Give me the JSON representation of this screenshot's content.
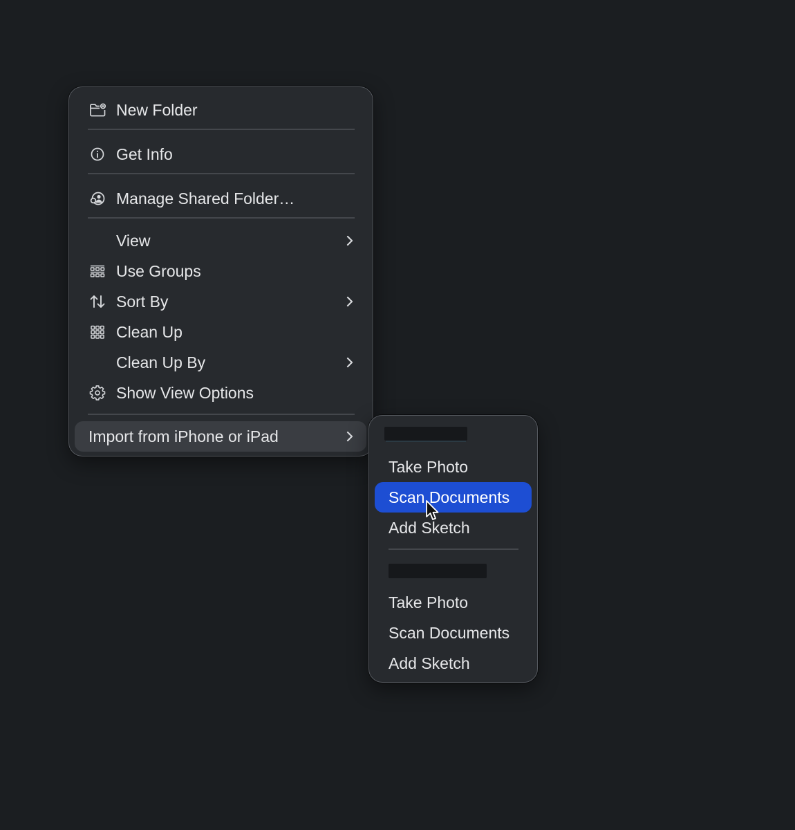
{
  "main_menu": {
    "items": [
      {
        "label": "New Folder",
        "icon": "new-folder-icon"
      },
      {
        "label": "Get Info",
        "icon": "info-icon"
      },
      {
        "label": "Manage Shared Folder…",
        "icon": "shared-folder-icon"
      },
      {
        "label": "View",
        "has_submenu": true
      },
      {
        "label": "Use Groups",
        "icon": "use-groups-icon"
      },
      {
        "label": "Sort By",
        "icon": "sort-icon",
        "has_submenu": true
      },
      {
        "label": "Clean Up",
        "icon": "grid-icon"
      },
      {
        "label": "Clean Up By",
        "has_submenu": true
      },
      {
        "label": "Show View Options",
        "icon": "gear-icon"
      },
      {
        "label": "Import from iPhone or iPad",
        "has_submenu": true,
        "highlighted": true
      }
    ]
  },
  "submenu": {
    "groups": [
      {
        "device_name": "",
        "items": [
          "Take Photo",
          "Scan Documents",
          "Add Sketch"
        ],
        "selected_index": 1
      },
      {
        "device_name": "",
        "items": [
          "Take Photo",
          "Scan Documents",
          "Add Sketch"
        ]
      }
    ]
  },
  "colors": {
    "background": "#1b1e21",
    "menu": "#272a2e",
    "selection_accent": "#1d4ed3",
    "hover": "#3a3d42"
  }
}
